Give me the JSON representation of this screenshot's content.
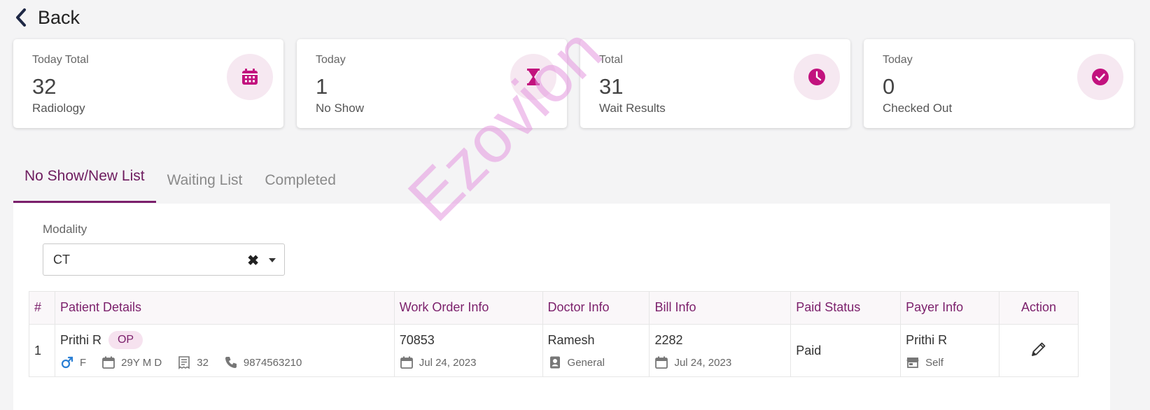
{
  "nav": {
    "back_label": "Back"
  },
  "summary_cards": [
    {
      "sub": "Today Total",
      "value": "32",
      "label": "Radiology",
      "icon": "calendar-icon"
    },
    {
      "sub": "Today",
      "value": "1",
      "label": "No Show",
      "icon": "hourglass-icon"
    },
    {
      "sub": "Total",
      "value": "31",
      "label": "Wait Results",
      "icon": "clock-icon"
    },
    {
      "sub": "Today",
      "value": "0",
      "label": "Checked Out",
      "icon": "check-circle-icon"
    }
  ],
  "tabs": [
    {
      "label": "No Show/New List",
      "active": true
    },
    {
      "label": "Waiting List",
      "active": false
    },
    {
      "label": "Completed",
      "active": false
    }
  ],
  "filter": {
    "label": "Modality",
    "selected": "CT",
    "clear_glyph": "✖"
  },
  "table": {
    "headers": {
      "num": "#",
      "patient": "Patient Details",
      "work_order": "Work Order Info",
      "doctor": "Doctor Info",
      "bill": "Bill Info",
      "paid": "Paid Status",
      "payer": "Payer Info",
      "action": "Action"
    },
    "rows": [
      {
        "num": "1",
        "patient_name": "Prithi R",
        "patient_type": "OP",
        "gender": "F",
        "age": "29Y M D",
        "record_no": "32",
        "phone": "9874563210",
        "work_order_no": "70853",
        "work_order_date": "Jul 24, 2023",
        "doctor_name": "Ramesh",
        "doctor_dept": "General",
        "bill_no": "2282",
        "bill_date": "Jul 24, 2023",
        "paid_status": "Paid",
        "payer_name": "Prithi R",
        "payer_type": "Self"
      }
    ]
  },
  "watermark": "Ezovion",
  "colors": {
    "accent": "#7b1f6b",
    "icon_magenta": "#c2127e",
    "icon_bg": "#f6e8f1",
    "male_icon": "#2a7fd4"
  }
}
